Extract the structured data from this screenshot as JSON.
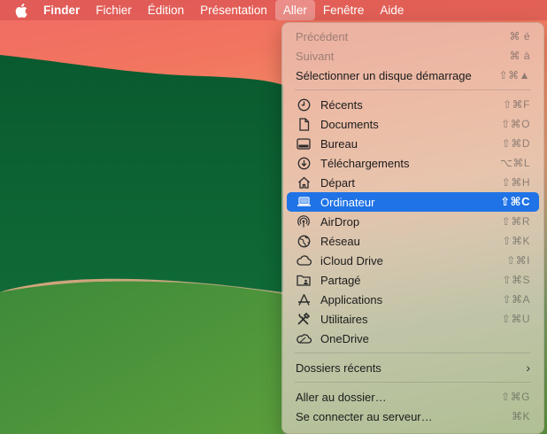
{
  "menubar": {
    "app_name": "Finder",
    "items": [
      "Fichier",
      "Édition",
      "Présentation",
      "Aller",
      "Fenêtre",
      "Aide"
    ]
  },
  "go_menu": {
    "nav": [
      {
        "label": "Précédent",
        "shortcut": "⌘ é"
      },
      {
        "label": "Suivant",
        "shortcut": "⌘ à"
      },
      {
        "label": "Sélectionner un disque démarrage",
        "shortcut": "⇧⌘▲"
      }
    ],
    "places": [
      {
        "label": "Récents",
        "shortcut": "⇧⌘F",
        "icon": "clock-icon"
      },
      {
        "label": "Documents",
        "shortcut": "⇧⌘O",
        "icon": "document-icon"
      },
      {
        "label": "Bureau",
        "shortcut": "⇧⌘D",
        "icon": "desktop-icon"
      },
      {
        "label": "Téléchargements",
        "shortcut": "⌥⌘L",
        "icon": "download-icon"
      },
      {
        "label": "Départ",
        "shortcut": "⇧⌘H",
        "icon": "home-icon"
      },
      {
        "label": "Ordinateur",
        "shortcut": "⇧⌘C",
        "icon": "laptop-icon"
      },
      {
        "label": "AirDrop",
        "shortcut": "⇧⌘R",
        "icon": "airdrop-icon"
      },
      {
        "label": "Réseau",
        "shortcut": "⇧⌘K",
        "icon": "globe-icon"
      },
      {
        "label": "iCloud Drive",
        "shortcut": "⇧⌘I",
        "icon": "cloud-icon"
      },
      {
        "label": "Partagé",
        "shortcut": "⇧⌘S",
        "icon": "shared-folder-icon"
      },
      {
        "label": "Applications",
        "shortcut": "⇧⌘A",
        "icon": "applications-icon"
      },
      {
        "label": "Utilitaires",
        "shortcut": "⇧⌘U",
        "icon": "utilities-icon"
      },
      {
        "label": "OneDrive",
        "shortcut": "",
        "icon": "onedrive-icon"
      }
    ],
    "recent_folders": {
      "label": "Dossiers récents"
    },
    "goto": [
      {
        "label": "Aller au dossier…",
        "shortcut": "⇧⌘G"
      },
      {
        "label": "Se connecter au serveur…",
        "shortcut": "⌘K"
      }
    ]
  },
  "colors": {
    "highlight": "#1f73e6",
    "wallpaper_green": "#0b5a32",
    "wallpaper_red": "#f06a64"
  }
}
